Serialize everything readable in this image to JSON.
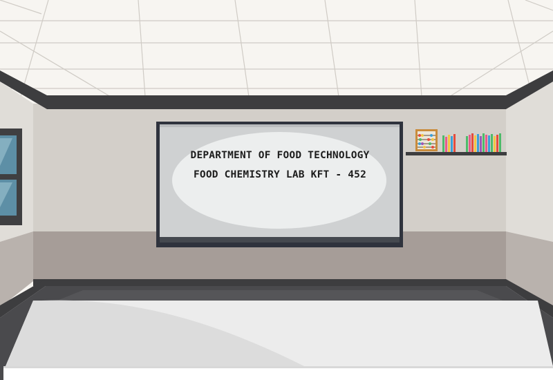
{
  "classroom": {
    "screen": {
      "line1": "DEPARTMENT OF FOOD TECHNOLOGY",
      "line2": "FOOD CHEMISTRY LAB KFT - 452"
    },
    "colors": {
      "ceiling": "#f7f5f1",
      "ceiling_grid": "#cfcbc5",
      "trim": "#3d3d3f",
      "wall_upper": "#d3cfc9",
      "wall_lower": "#a69d98",
      "side_wall_upper": "#e0ddd8",
      "side_wall_lower": "#b9b2ad",
      "screen_frame": "#2f333d",
      "screen_face": "#cfd1d2",
      "table_top": "#ececec",
      "window_glass": "#5d8fa6"
    },
    "icons": [
      "abacus-icon",
      "book-icon"
    ]
  }
}
